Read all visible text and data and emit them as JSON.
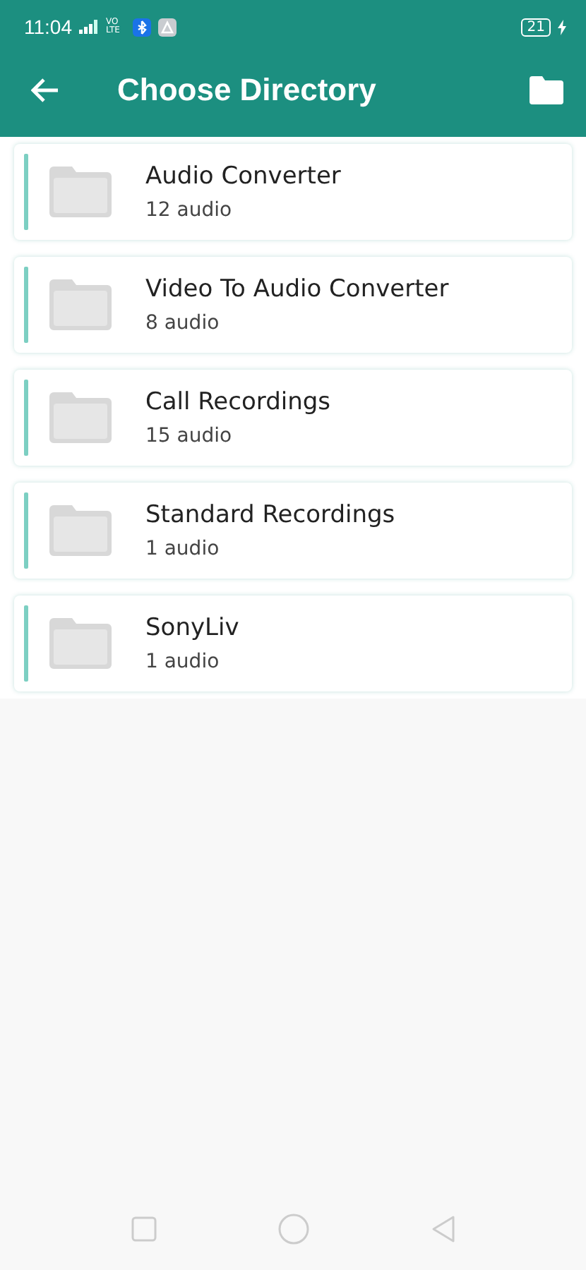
{
  "status_bar": {
    "time": "11:04",
    "network": "VO LTE",
    "battery": "21"
  },
  "toolbar": {
    "title": "Choose Directory"
  },
  "folders": [
    {
      "name": "Audio Converter",
      "count": "12 audio"
    },
    {
      "name": "Video To Audio Converter",
      "count": "8 audio"
    },
    {
      "name": "Call Recordings",
      "count": "15 audio"
    },
    {
      "name": "Standard Recordings",
      "count": "1 audio"
    },
    {
      "name": "SonyLiv",
      "count": "1 audio"
    }
  ]
}
